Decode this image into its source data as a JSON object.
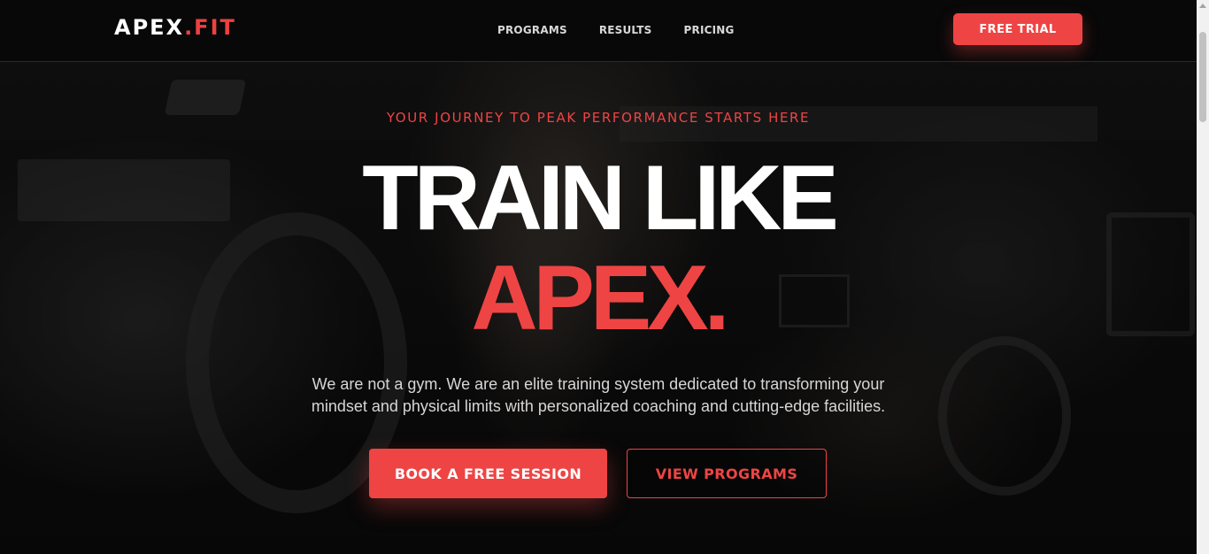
{
  "brand": {
    "name_main": "APEX",
    "name_accent": ".FIT",
    "accent_color": "#ef4444"
  },
  "nav": {
    "items": [
      {
        "label": "PROGRAMS"
      },
      {
        "label": "RESULTS"
      },
      {
        "label": "PRICING"
      }
    ],
    "cta_label": "FREE TRIAL"
  },
  "hero": {
    "eyebrow": "YOUR JOURNEY TO PEAK PERFORMANCE STARTS HERE",
    "headline_line1": "TRAIN LIKE",
    "headline_line2": "APEX.",
    "description": "We are not a gym. We are an elite training system dedicated to transforming your mindset and physical limits with personalized coaching and cutting-edge facilities.",
    "primary_cta": "BOOK A FREE SESSION",
    "secondary_cta": "VIEW PROGRAMS",
    "background_image": "gym-athlete-photo"
  }
}
